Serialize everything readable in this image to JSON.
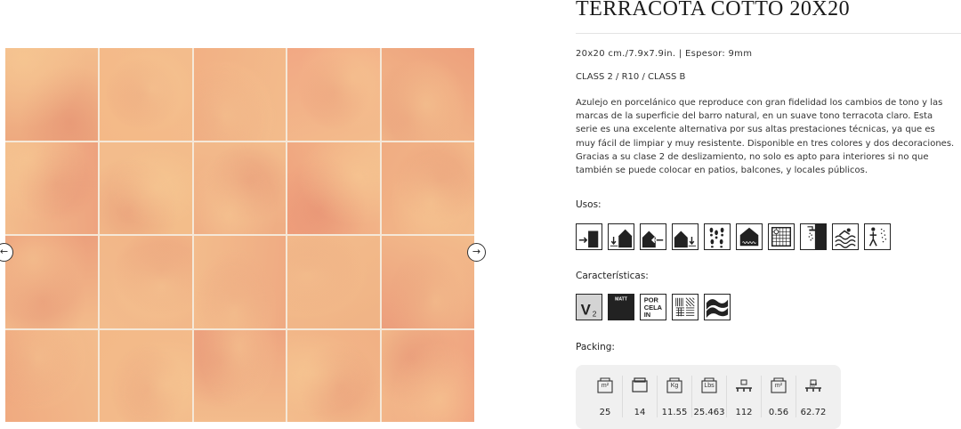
{
  "product": {
    "title": "TERRACOTA COTTO 20X20",
    "dimensions": "20x20 cm./7.9x7.9in. | Espesor: 9mm",
    "classification": "CLASS 2 / R10 / CLASS B",
    "description": "Azulejo en porcelánico que reproduce con gran fidelidad los cambios de tono y las marcas de la superficie del barro natural, en un suave tono terracota claro. Esta serie es una excelente alternativa por sus altas prestaciones técnicas, ya que es muy fácil de limpiar y muy resistente. Disponible en tres colores y dos decoraciones. Gracias a su clase 2 de deslizamiento, no solo es apto para interiores si no que también se puede colocar en patios, balcones, y locales públicos."
  },
  "gallery": {
    "prev_label": "←",
    "next_label": "→",
    "tile_colors": [
      "#eeaa80",
      "#f4b987",
      "#f2b084",
      "#f2a884",
      "#eda07c",
      "#eda27e",
      "#f3bd8a",
      "#eeaa82",
      "#ef9f7c",
      "#f0ac82",
      "#eb9c7a",
      "#f1b386",
      "#efaa82",
      "#f0b385",
      "#ec9e7c",
      "#f0aa80",
      "#f3b988",
      "#eea580",
      "#f1b084",
      "#ef9f7e"
    ]
  },
  "uses": {
    "label": "Usos:",
    "icons": [
      "interior-wall-icon",
      "interior-floor-icon",
      "exterior-wall-icon",
      "exterior-floor-icon",
      "footprints-traffic-icon",
      "heated-floor-icon",
      "pool-tile-icon",
      "shower-icon",
      "swimming-pool-icon",
      "wet-area-icon"
    ]
  },
  "features": {
    "label": "Características:",
    "matt_label": "MATT",
    "porcelain_label": [
      "POR",
      "CELA",
      "IN"
    ],
    "v_label": "V",
    "v_sub": "2",
    "icons": [
      "shade-variation-icon",
      "matt-finish-icon",
      "porcelain-icon",
      "random-pattern-icon",
      "wave-surface-icon"
    ]
  },
  "packing": {
    "label": "Packing:",
    "columns": [
      {
        "icon": "m2-icon",
        "icon_text": "m²",
        "value": "25"
      },
      {
        "icon": "pieces-box-icon",
        "icon_text": "",
        "value": "14"
      },
      {
        "icon": "kg-icon",
        "icon_text": "Kg",
        "value": "11.55"
      },
      {
        "icon": "lbs-icon",
        "icon_text": "Lbs",
        "value": "25.463"
      },
      {
        "icon": "boxes-pallet-icon",
        "icon_text": "",
        "value": "112"
      },
      {
        "icon": "m2-box-icon",
        "icon_text": "m²",
        "value": "0.56"
      },
      {
        "icon": "m2-pallet-icon",
        "icon_text": "m²",
        "value": "62.72"
      }
    ]
  }
}
